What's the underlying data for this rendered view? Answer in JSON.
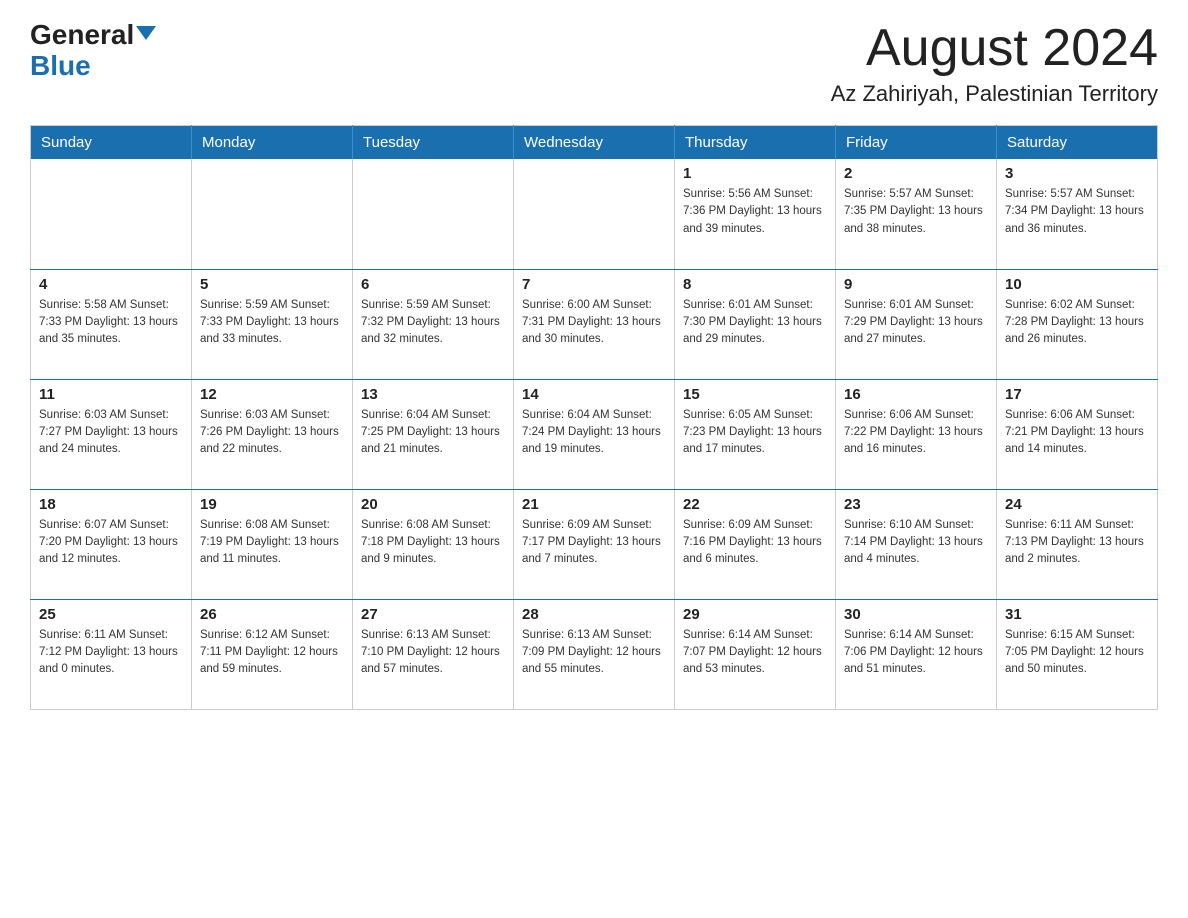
{
  "header": {
    "logo_general": "General",
    "logo_blue": "Blue",
    "title": "August 2024",
    "subtitle": "Az Zahiriyah, Palestinian Territory"
  },
  "weekdays": [
    "Sunday",
    "Monday",
    "Tuesday",
    "Wednesday",
    "Thursday",
    "Friday",
    "Saturday"
  ],
  "weeks": [
    [
      {
        "day": "",
        "info": ""
      },
      {
        "day": "",
        "info": ""
      },
      {
        "day": "",
        "info": ""
      },
      {
        "day": "",
        "info": ""
      },
      {
        "day": "1",
        "info": "Sunrise: 5:56 AM\nSunset: 7:36 PM\nDaylight: 13 hours and 39 minutes."
      },
      {
        "day": "2",
        "info": "Sunrise: 5:57 AM\nSunset: 7:35 PM\nDaylight: 13 hours and 38 minutes."
      },
      {
        "day": "3",
        "info": "Sunrise: 5:57 AM\nSunset: 7:34 PM\nDaylight: 13 hours and 36 minutes."
      }
    ],
    [
      {
        "day": "4",
        "info": "Sunrise: 5:58 AM\nSunset: 7:33 PM\nDaylight: 13 hours and 35 minutes."
      },
      {
        "day": "5",
        "info": "Sunrise: 5:59 AM\nSunset: 7:33 PM\nDaylight: 13 hours and 33 minutes."
      },
      {
        "day": "6",
        "info": "Sunrise: 5:59 AM\nSunset: 7:32 PM\nDaylight: 13 hours and 32 minutes."
      },
      {
        "day": "7",
        "info": "Sunrise: 6:00 AM\nSunset: 7:31 PM\nDaylight: 13 hours and 30 minutes."
      },
      {
        "day": "8",
        "info": "Sunrise: 6:01 AM\nSunset: 7:30 PM\nDaylight: 13 hours and 29 minutes."
      },
      {
        "day": "9",
        "info": "Sunrise: 6:01 AM\nSunset: 7:29 PM\nDaylight: 13 hours and 27 minutes."
      },
      {
        "day": "10",
        "info": "Sunrise: 6:02 AM\nSunset: 7:28 PM\nDaylight: 13 hours and 26 minutes."
      }
    ],
    [
      {
        "day": "11",
        "info": "Sunrise: 6:03 AM\nSunset: 7:27 PM\nDaylight: 13 hours and 24 minutes."
      },
      {
        "day": "12",
        "info": "Sunrise: 6:03 AM\nSunset: 7:26 PM\nDaylight: 13 hours and 22 minutes."
      },
      {
        "day": "13",
        "info": "Sunrise: 6:04 AM\nSunset: 7:25 PM\nDaylight: 13 hours and 21 minutes."
      },
      {
        "day": "14",
        "info": "Sunrise: 6:04 AM\nSunset: 7:24 PM\nDaylight: 13 hours and 19 minutes."
      },
      {
        "day": "15",
        "info": "Sunrise: 6:05 AM\nSunset: 7:23 PM\nDaylight: 13 hours and 17 minutes."
      },
      {
        "day": "16",
        "info": "Sunrise: 6:06 AM\nSunset: 7:22 PM\nDaylight: 13 hours and 16 minutes."
      },
      {
        "day": "17",
        "info": "Sunrise: 6:06 AM\nSunset: 7:21 PM\nDaylight: 13 hours and 14 minutes."
      }
    ],
    [
      {
        "day": "18",
        "info": "Sunrise: 6:07 AM\nSunset: 7:20 PM\nDaylight: 13 hours and 12 minutes."
      },
      {
        "day": "19",
        "info": "Sunrise: 6:08 AM\nSunset: 7:19 PM\nDaylight: 13 hours and 11 minutes."
      },
      {
        "day": "20",
        "info": "Sunrise: 6:08 AM\nSunset: 7:18 PM\nDaylight: 13 hours and 9 minutes."
      },
      {
        "day": "21",
        "info": "Sunrise: 6:09 AM\nSunset: 7:17 PM\nDaylight: 13 hours and 7 minutes."
      },
      {
        "day": "22",
        "info": "Sunrise: 6:09 AM\nSunset: 7:16 PM\nDaylight: 13 hours and 6 minutes."
      },
      {
        "day": "23",
        "info": "Sunrise: 6:10 AM\nSunset: 7:14 PM\nDaylight: 13 hours and 4 minutes."
      },
      {
        "day": "24",
        "info": "Sunrise: 6:11 AM\nSunset: 7:13 PM\nDaylight: 13 hours and 2 minutes."
      }
    ],
    [
      {
        "day": "25",
        "info": "Sunrise: 6:11 AM\nSunset: 7:12 PM\nDaylight: 13 hours and 0 minutes."
      },
      {
        "day": "26",
        "info": "Sunrise: 6:12 AM\nSunset: 7:11 PM\nDaylight: 12 hours and 59 minutes."
      },
      {
        "day": "27",
        "info": "Sunrise: 6:13 AM\nSunset: 7:10 PM\nDaylight: 12 hours and 57 minutes."
      },
      {
        "day": "28",
        "info": "Sunrise: 6:13 AM\nSunset: 7:09 PM\nDaylight: 12 hours and 55 minutes."
      },
      {
        "day": "29",
        "info": "Sunrise: 6:14 AM\nSunset: 7:07 PM\nDaylight: 12 hours and 53 minutes."
      },
      {
        "day": "30",
        "info": "Sunrise: 6:14 AM\nSunset: 7:06 PM\nDaylight: 12 hours and 51 minutes."
      },
      {
        "day": "31",
        "info": "Sunrise: 6:15 AM\nSunset: 7:05 PM\nDaylight: 12 hours and 50 minutes."
      }
    ]
  ]
}
